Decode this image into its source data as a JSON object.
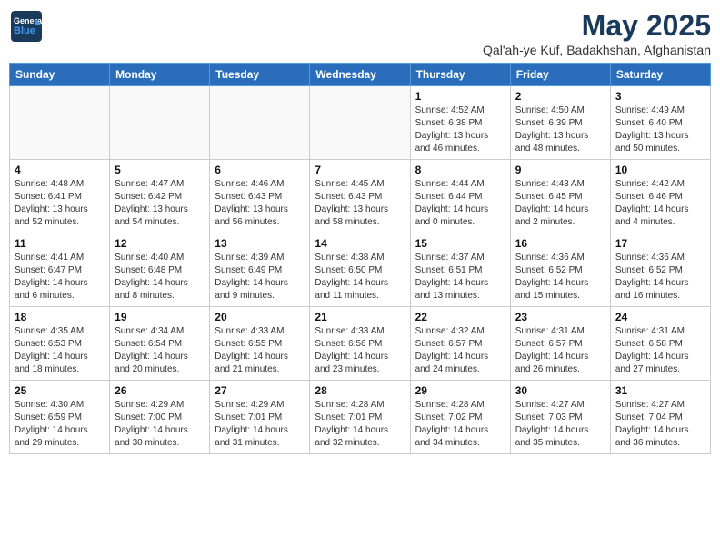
{
  "logo": {
    "general": "General",
    "blue": "Blue"
  },
  "title": "May 2025",
  "subtitle": "Qal'ah-ye Kuf, Badakhshan, Afghanistan",
  "days_of_week": [
    "Sunday",
    "Monday",
    "Tuesday",
    "Wednesday",
    "Thursday",
    "Friday",
    "Saturday"
  ],
  "weeks": [
    [
      {
        "day": "",
        "info": ""
      },
      {
        "day": "",
        "info": ""
      },
      {
        "day": "",
        "info": ""
      },
      {
        "day": "",
        "info": ""
      },
      {
        "day": "1",
        "sunrise": "Sunrise: 4:52 AM",
        "sunset": "Sunset: 6:38 PM",
        "daylight": "Daylight: 13 hours and 46 minutes."
      },
      {
        "day": "2",
        "sunrise": "Sunrise: 4:50 AM",
        "sunset": "Sunset: 6:39 PM",
        "daylight": "Daylight: 13 hours and 48 minutes."
      },
      {
        "day": "3",
        "sunrise": "Sunrise: 4:49 AM",
        "sunset": "Sunset: 6:40 PM",
        "daylight": "Daylight: 13 hours and 50 minutes."
      }
    ],
    [
      {
        "day": "4",
        "sunrise": "Sunrise: 4:48 AM",
        "sunset": "Sunset: 6:41 PM",
        "daylight": "Daylight: 13 hours and 52 minutes."
      },
      {
        "day": "5",
        "sunrise": "Sunrise: 4:47 AM",
        "sunset": "Sunset: 6:42 PM",
        "daylight": "Daylight: 13 hours and 54 minutes."
      },
      {
        "day": "6",
        "sunrise": "Sunrise: 4:46 AM",
        "sunset": "Sunset: 6:43 PM",
        "daylight": "Daylight: 13 hours and 56 minutes."
      },
      {
        "day": "7",
        "sunrise": "Sunrise: 4:45 AM",
        "sunset": "Sunset: 6:43 PM",
        "daylight": "Daylight: 13 hours and 58 minutes."
      },
      {
        "day": "8",
        "sunrise": "Sunrise: 4:44 AM",
        "sunset": "Sunset: 6:44 PM",
        "daylight": "Daylight: 14 hours and 0 minutes."
      },
      {
        "day": "9",
        "sunrise": "Sunrise: 4:43 AM",
        "sunset": "Sunset: 6:45 PM",
        "daylight": "Daylight: 14 hours and 2 minutes."
      },
      {
        "day": "10",
        "sunrise": "Sunrise: 4:42 AM",
        "sunset": "Sunset: 6:46 PM",
        "daylight": "Daylight: 14 hours and 4 minutes."
      }
    ],
    [
      {
        "day": "11",
        "sunrise": "Sunrise: 4:41 AM",
        "sunset": "Sunset: 6:47 PM",
        "daylight": "Daylight: 14 hours and 6 minutes."
      },
      {
        "day": "12",
        "sunrise": "Sunrise: 4:40 AM",
        "sunset": "Sunset: 6:48 PM",
        "daylight": "Daylight: 14 hours and 8 minutes."
      },
      {
        "day": "13",
        "sunrise": "Sunrise: 4:39 AM",
        "sunset": "Sunset: 6:49 PM",
        "daylight": "Daylight: 14 hours and 9 minutes."
      },
      {
        "day": "14",
        "sunrise": "Sunrise: 4:38 AM",
        "sunset": "Sunset: 6:50 PM",
        "daylight": "Daylight: 14 hours and 11 minutes."
      },
      {
        "day": "15",
        "sunrise": "Sunrise: 4:37 AM",
        "sunset": "Sunset: 6:51 PM",
        "daylight": "Daylight: 14 hours and 13 minutes."
      },
      {
        "day": "16",
        "sunrise": "Sunrise: 4:36 AM",
        "sunset": "Sunset: 6:52 PM",
        "daylight": "Daylight: 14 hours and 15 minutes."
      },
      {
        "day": "17",
        "sunrise": "Sunrise: 4:36 AM",
        "sunset": "Sunset: 6:52 PM",
        "daylight": "Daylight: 14 hours and 16 minutes."
      }
    ],
    [
      {
        "day": "18",
        "sunrise": "Sunrise: 4:35 AM",
        "sunset": "Sunset: 6:53 PM",
        "daylight": "Daylight: 14 hours and 18 minutes."
      },
      {
        "day": "19",
        "sunrise": "Sunrise: 4:34 AM",
        "sunset": "Sunset: 6:54 PM",
        "daylight": "Daylight: 14 hours and 20 minutes."
      },
      {
        "day": "20",
        "sunrise": "Sunrise: 4:33 AM",
        "sunset": "Sunset: 6:55 PM",
        "daylight": "Daylight: 14 hours and 21 minutes."
      },
      {
        "day": "21",
        "sunrise": "Sunrise: 4:33 AM",
        "sunset": "Sunset: 6:56 PM",
        "daylight": "Daylight: 14 hours and 23 minutes."
      },
      {
        "day": "22",
        "sunrise": "Sunrise: 4:32 AM",
        "sunset": "Sunset: 6:57 PM",
        "daylight": "Daylight: 14 hours and 24 minutes."
      },
      {
        "day": "23",
        "sunrise": "Sunrise: 4:31 AM",
        "sunset": "Sunset: 6:57 PM",
        "daylight": "Daylight: 14 hours and 26 minutes."
      },
      {
        "day": "24",
        "sunrise": "Sunrise: 4:31 AM",
        "sunset": "Sunset: 6:58 PM",
        "daylight": "Daylight: 14 hours and 27 minutes."
      }
    ],
    [
      {
        "day": "25",
        "sunrise": "Sunrise: 4:30 AM",
        "sunset": "Sunset: 6:59 PM",
        "daylight": "Daylight: 14 hours and 29 minutes."
      },
      {
        "day": "26",
        "sunrise": "Sunrise: 4:29 AM",
        "sunset": "Sunset: 7:00 PM",
        "daylight": "Daylight: 14 hours and 30 minutes."
      },
      {
        "day": "27",
        "sunrise": "Sunrise: 4:29 AM",
        "sunset": "Sunset: 7:01 PM",
        "daylight": "Daylight: 14 hours and 31 minutes."
      },
      {
        "day": "28",
        "sunrise": "Sunrise: 4:28 AM",
        "sunset": "Sunset: 7:01 PM",
        "daylight": "Daylight: 14 hours and 32 minutes."
      },
      {
        "day": "29",
        "sunrise": "Sunrise: 4:28 AM",
        "sunset": "Sunset: 7:02 PM",
        "daylight": "Daylight: 14 hours and 34 minutes."
      },
      {
        "day": "30",
        "sunrise": "Sunrise: 4:27 AM",
        "sunset": "Sunset: 7:03 PM",
        "daylight": "Daylight: 14 hours and 35 minutes."
      },
      {
        "day": "31",
        "sunrise": "Sunrise: 4:27 AM",
        "sunset": "Sunset: 7:04 PM",
        "daylight": "Daylight: 14 hours and 36 minutes."
      }
    ]
  ]
}
